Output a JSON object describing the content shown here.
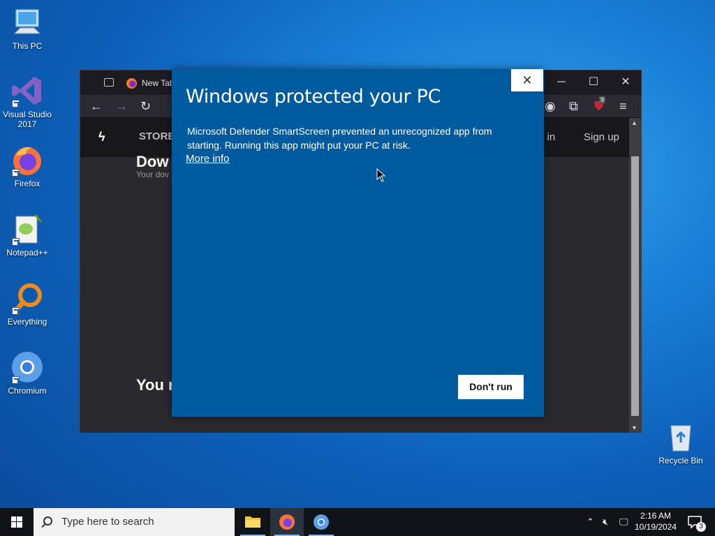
{
  "desktop": {
    "icons": [
      {
        "label": "This PC"
      },
      {
        "label": "Visual Studio 2017"
      },
      {
        "label": "Firefox"
      },
      {
        "label": "Notepad++"
      },
      {
        "label": "Everything"
      },
      {
        "label": "Chromium"
      },
      {
        "label": "Recycle Bin"
      }
    ]
  },
  "browser": {
    "tab_title": "New Tab",
    "site_nav": {
      "store": "STORE",
      "login": "g in",
      "signup": "Sign up"
    },
    "page": {
      "heading": "Dow",
      "subtext": "Your dov",
      "bottom_heading": "You r"
    },
    "extension_badge": "9"
  },
  "dialog": {
    "title": "Windows protected your PC",
    "message": "Microsoft Defender SmartScreen prevented an unrecognized app from starting. Running this app might put your PC at risk.",
    "more_info": "More info",
    "dont_run": "Don't run",
    "close_glyph": "✕",
    "bg_color": "#005a9e"
  },
  "taskbar": {
    "search_placeholder": "Type here to search",
    "time": "2:16 AM",
    "date": "10/19/2024",
    "notification_count": "3"
  }
}
